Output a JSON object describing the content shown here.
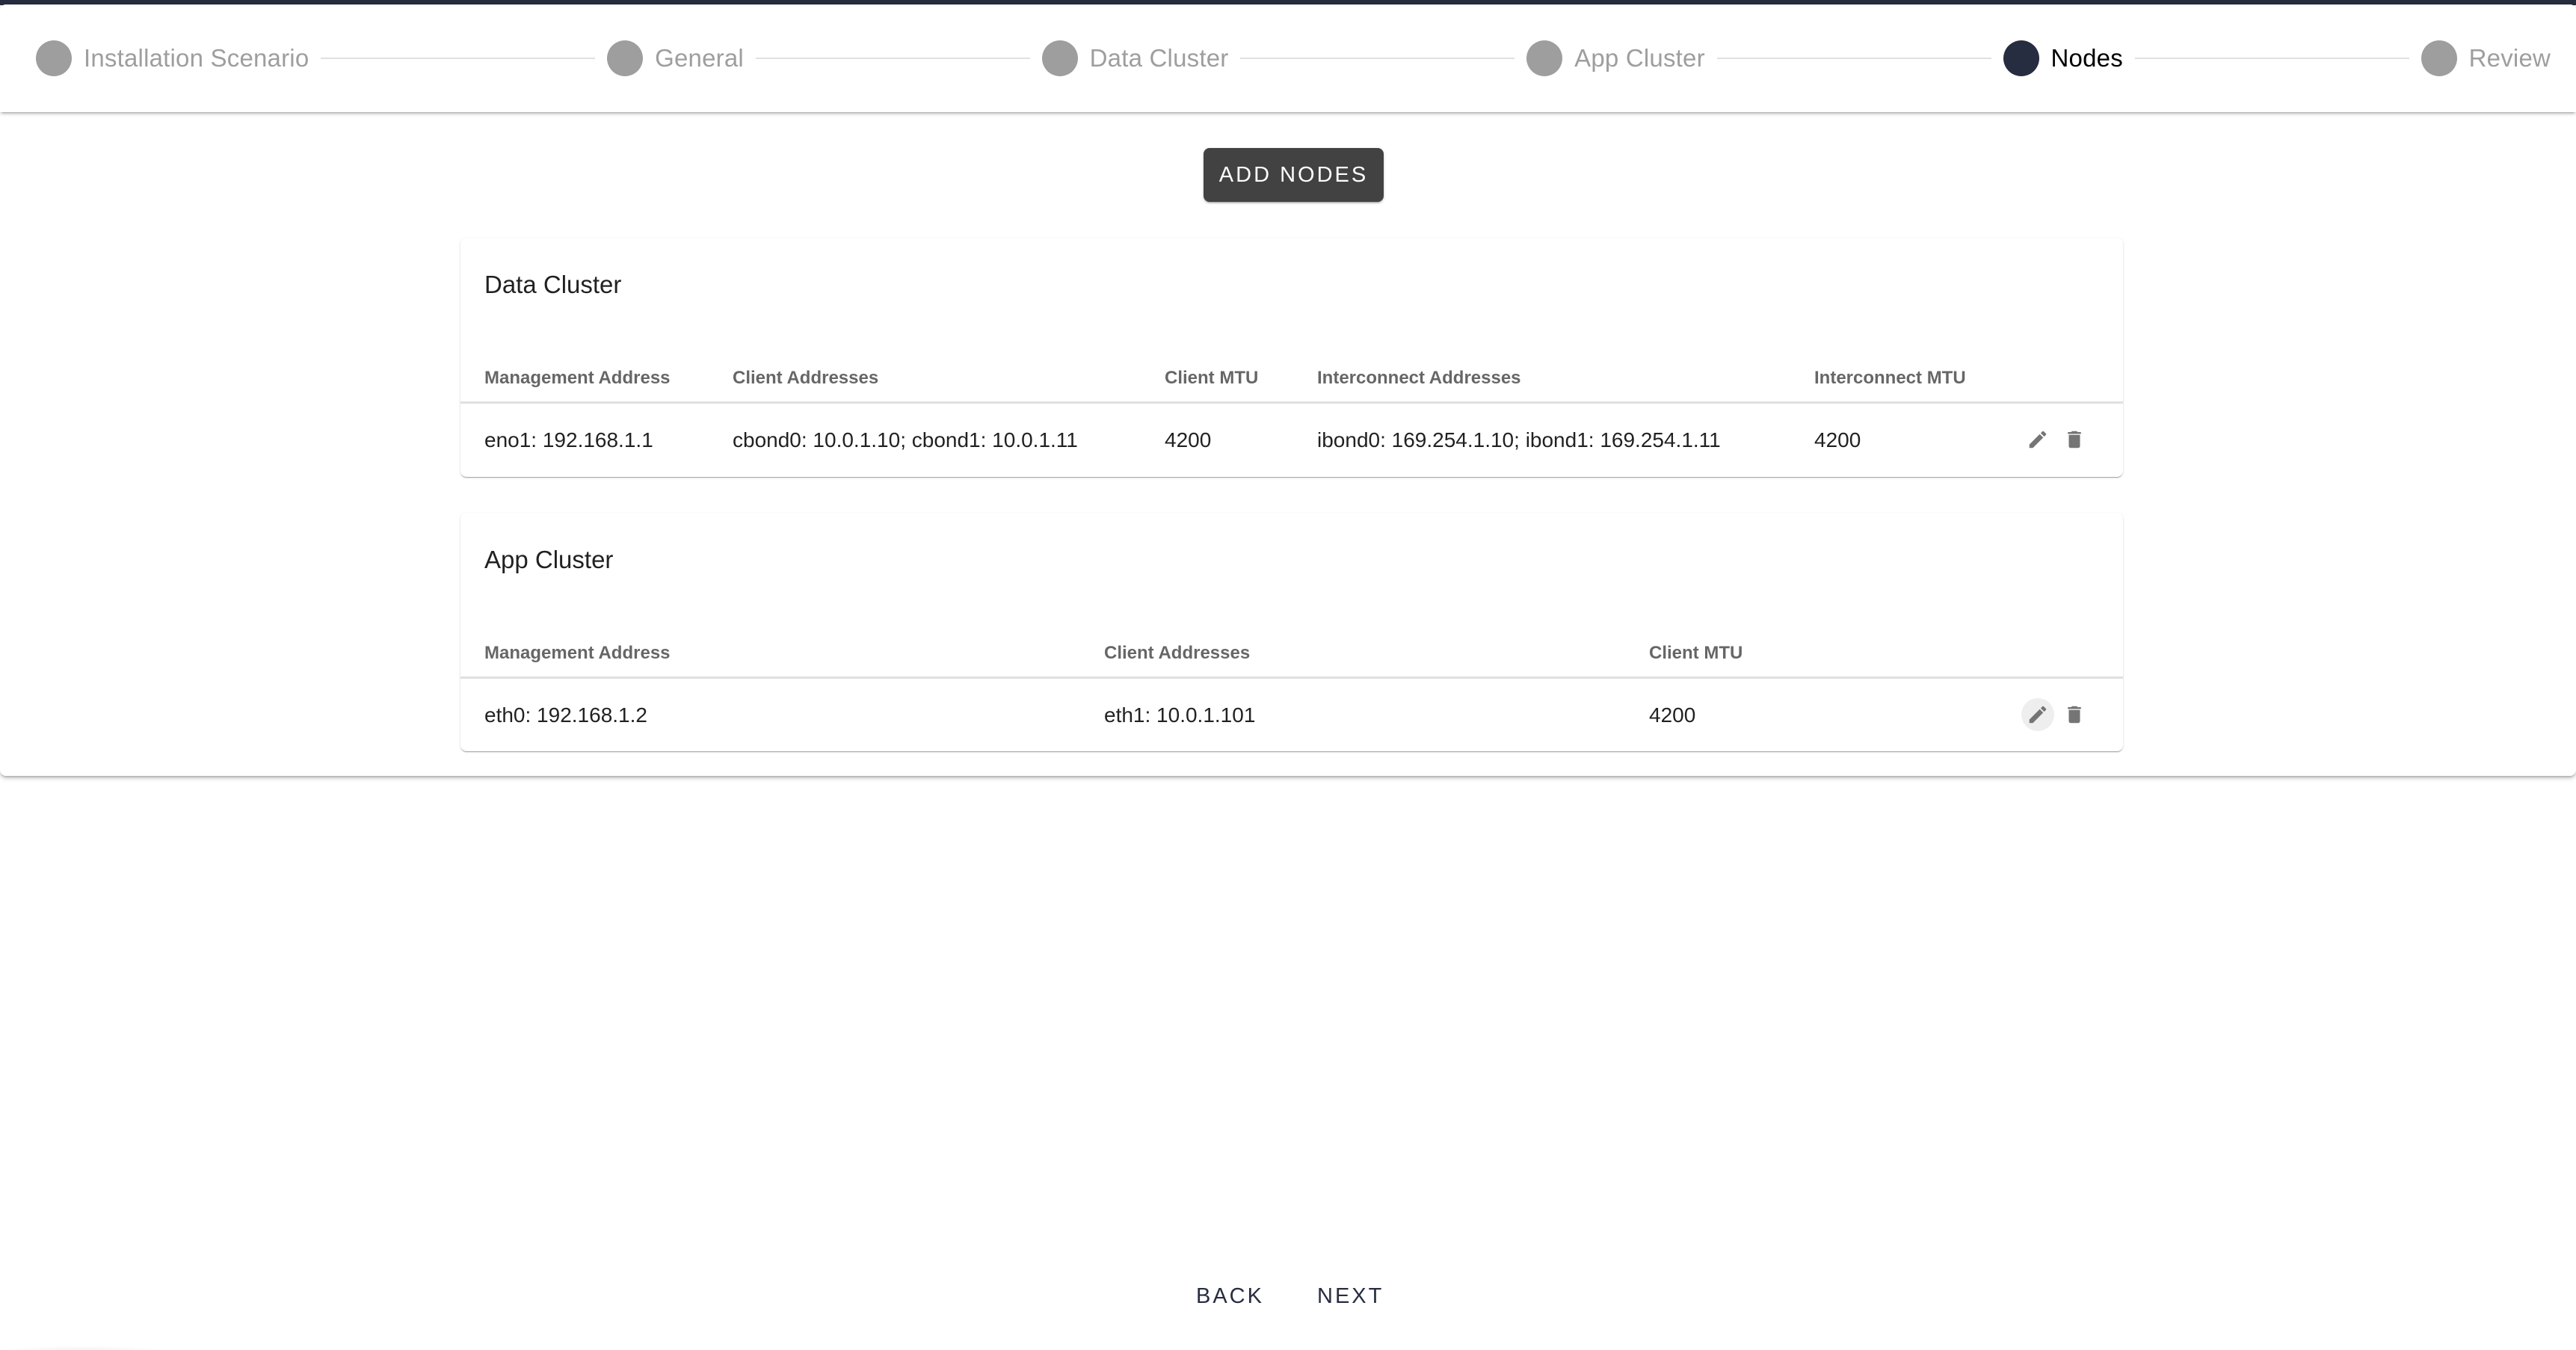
{
  "stepper": {
    "steps": [
      {
        "label": "Installation Scenario",
        "state": "inactive"
      },
      {
        "label": "General",
        "state": "inactive"
      },
      {
        "label": "Data Cluster",
        "state": "inactive"
      },
      {
        "label": "App Cluster",
        "state": "inactive"
      },
      {
        "label": "Nodes",
        "state": "active"
      },
      {
        "label": "Review",
        "state": "inactive"
      }
    ]
  },
  "toolbar": {
    "add_nodes_label": "ADD NODES"
  },
  "data_cluster": {
    "title": "Data Cluster",
    "columns": [
      "Management Address",
      "Client Addresses",
      "Client MTU",
      "Interconnect Addresses",
      "Interconnect MTU"
    ],
    "rows": [
      {
        "management_address": "eno1: 192.168.1.1",
        "client_addresses": "cbond0: 10.0.1.10; cbond1: 10.0.1.11",
        "client_mtu": "4200",
        "interconnect_addresses": "ibond0: 169.254.1.10; ibond1: 169.254.1.11",
        "interconnect_mtu": "4200",
        "actions": [
          "edit-icon",
          "delete-icon"
        ]
      }
    ]
  },
  "app_cluster": {
    "title": "App Cluster",
    "columns": [
      "Management Address",
      "Client Addresses",
      "Client MTU"
    ],
    "rows": [
      {
        "management_address": "eth0: 192.168.1.2",
        "client_addresses": "eth1: 10.0.1.101",
        "client_mtu": "4200",
        "actions": [
          "edit-icon",
          "delete-icon"
        ]
      }
    ]
  },
  "navigation": {
    "back_label": "BACK",
    "next_label": "NEXT"
  },
  "colors": {
    "primary": "#272d40",
    "inactive_step": "#9e9e9e",
    "add_button_bg": "#424242",
    "icon": "#757575"
  }
}
